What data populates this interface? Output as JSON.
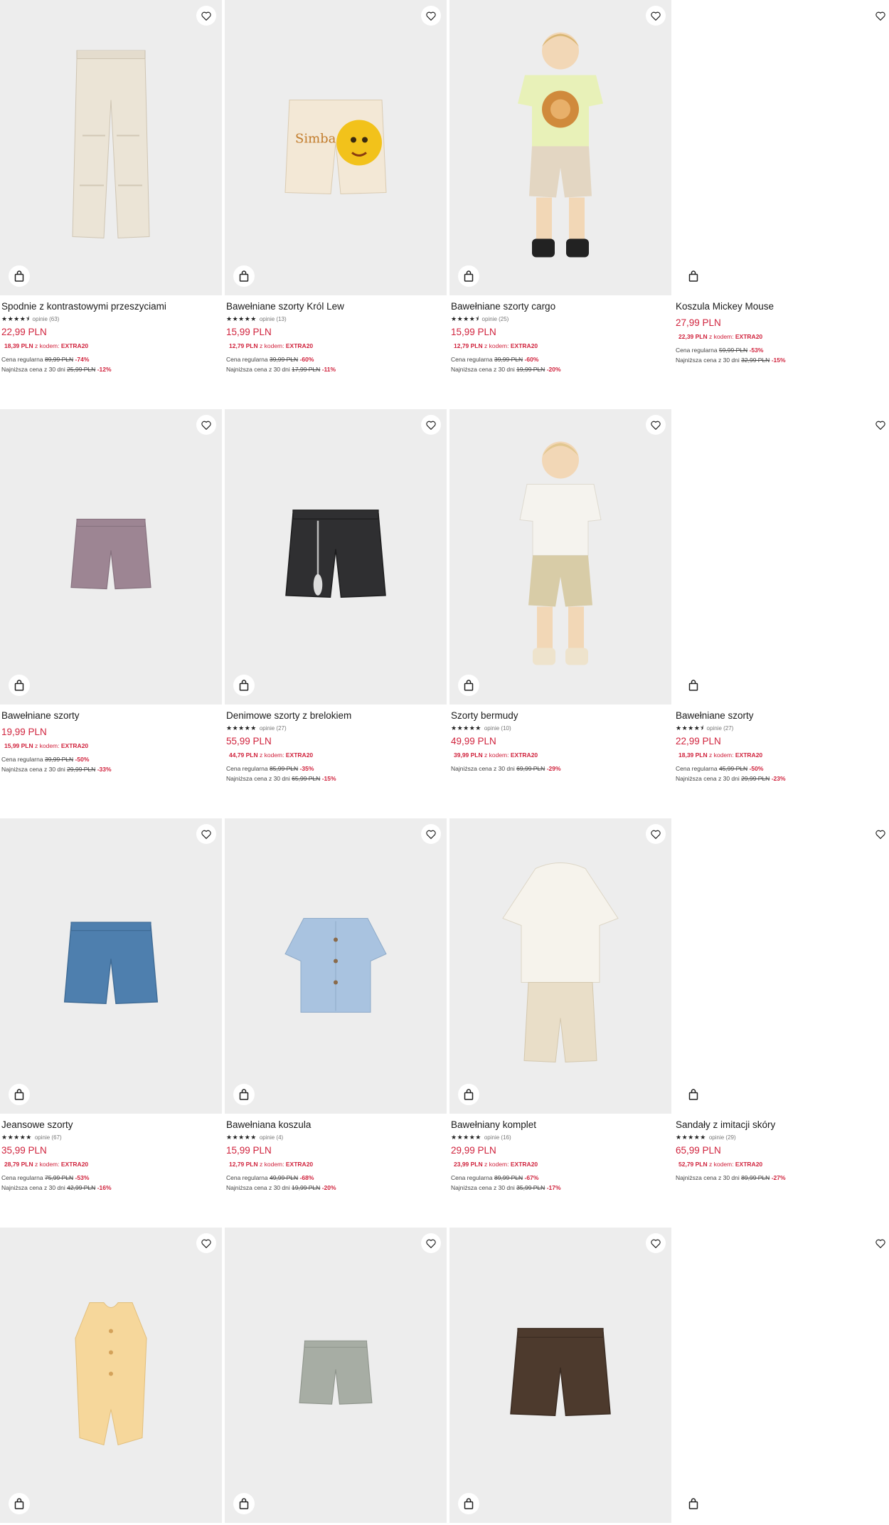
{
  "colors": {
    "price": "#d0223c",
    "image_bg": "#ededed"
  },
  "icons": {
    "wishlist": "heart-outline-icon",
    "cart": "shopping-bag-icon",
    "star": "star-icon"
  },
  "products": [
    {
      "name": "Spodnie z kontrastowymi przeszyciami",
      "rating": 4.5,
      "stars": "★★★★⯨",
      "reviews": "opinie (63)",
      "price": "22,99 PLN",
      "promo_price": "18,39 PLN",
      "promo_text": "z kodem:",
      "promo_code": "EXTRA20",
      "regular_label": "Cena regularna",
      "regular_old": "89,99 PLN",
      "regular_pct": "-74%",
      "lowest_label": "Najniższa cena z 30 dni",
      "lowest_old": "25,99 PLN",
      "lowest_pct": "-12%"
    },
    {
      "name": "Bawełniane szorty Król Lew",
      "rating": 5,
      "stars": "★★★★★",
      "reviews": "opinie (13)",
      "price": "15,99 PLN",
      "promo_price": "12,79 PLN",
      "promo_text": "z kodem:",
      "promo_code": "EXTRA20",
      "regular_label": "Cena regularna",
      "regular_old": "39,99 PLN",
      "regular_pct": "-60%",
      "lowest_label": "Najniższa cena z 30 dni",
      "lowest_old": "17,99 PLN",
      "lowest_pct": "-11%"
    },
    {
      "name": "Bawełniane szorty cargo",
      "rating": 4.5,
      "stars": "★★★★⯨",
      "reviews": "opinie (25)",
      "price": "15,99 PLN",
      "promo_price": "12,79 PLN",
      "promo_text": "z kodem:",
      "promo_code": "EXTRA20",
      "regular_label": "Cena regularna",
      "regular_old": "39,99 PLN",
      "regular_pct": "-60%",
      "lowest_label": "Najniższa cena z 30 dni",
      "lowest_old": "19,99 PLN",
      "lowest_pct": "-20%"
    },
    {
      "name": "Koszula Mickey Mouse",
      "price": "27,99 PLN",
      "promo_price": "22,39 PLN",
      "promo_text": "z kodem:",
      "promo_code": "EXTRA20",
      "regular_label": "Cena regularna",
      "regular_old": "59,99 PLN",
      "regular_pct": "-53%",
      "lowest_label": "Najniższa cena z 30 dni",
      "lowest_old": "32,99 PLN",
      "lowest_pct": "-15%"
    },
    {
      "name": "Bawełniane szorty",
      "price": "19,99 PLN",
      "promo_price": "15,99 PLN",
      "promo_text": "z kodem:",
      "promo_code": "EXTRA20",
      "regular_label": "Cena regularna",
      "regular_old": "39,99 PLN",
      "regular_pct": "-50%",
      "lowest_label": "Najniższa cena z 30 dni",
      "lowest_old": "29,99 PLN",
      "lowest_pct": "-33%"
    },
    {
      "name": "Denimowe szorty z brelokiem",
      "rating": 5,
      "stars": "★★★★★",
      "reviews": "opinie (27)",
      "price": "55,99 PLN",
      "promo_price": "44,79 PLN",
      "promo_text": "z kodem:",
      "promo_code": "EXTRA20",
      "regular_label": "Cena regularna",
      "regular_old": "85,99 PLN",
      "regular_pct": "-35%",
      "lowest_label": "Najniższa cena z 30 dni",
      "lowest_old": "65,99 PLN",
      "lowest_pct": "-15%"
    },
    {
      "name": "Szorty bermudy",
      "rating": 5,
      "stars": "★★★★★",
      "reviews": "opinie (10)",
      "price": "49,99 PLN",
      "promo_price": "39,99 PLN",
      "promo_text": "z kodem:",
      "promo_code": "EXTRA20",
      "lowest_label": "Najniższa cena z 30 dni",
      "lowest_old": "69,99 PLN",
      "lowest_pct": "-29%"
    },
    {
      "name": "Bawełniane szorty",
      "rating": 4.5,
      "stars": "★★★★⯨",
      "reviews": "opinie (27)",
      "price": "22,99 PLN",
      "promo_price": "18,39 PLN",
      "promo_text": "z kodem:",
      "promo_code": "EXTRA20",
      "regular_label": "Cena regularna",
      "regular_old": "45,99 PLN",
      "regular_pct": "-50%",
      "lowest_label": "Najniższa cena z 30 dni",
      "lowest_old": "29,99 PLN",
      "lowest_pct": "-23%"
    },
    {
      "name": "Jeansowe szorty",
      "rating": 5,
      "stars": "★★★★★",
      "reviews": "opinie (67)",
      "price": "35,99 PLN",
      "promo_price": "28,79 PLN",
      "promo_text": "z kodem:",
      "promo_code": "EXTRA20",
      "regular_label": "Cena regularna",
      "regular_old": "75,99 PLN",
      "regular_pct": "-53%",
      "lowest_label": "Najniższa cena z 30 dni",
      "lowest_old": "42,99 PLN",
      "lowest_pct": "-16%"
    },
    {
      "name": "Bawełniana koszula",
      "rating": 5,
      "stars": "★★★★★",
      "reviews": "opinie (4)",
      "price": "15,99 PLN",
      "promo_price": "12,79 PLN",
      "promo_text": "z kodem:",
      "promo_code": "EXTRA20",
      "regular_label": "Cena regularna",
      "regular_old": "49,99 PLN",
      "regular_pct": "-68%",
      "lowest_label": "Najniższa cena z 30 dni",
      "lowest_old": "19,99 PLN",
      "lowest_pct": "-20%"
    },
    {
      "name": "Bawełniany komplet",
      "rating": 5,
      "stars": "★★★★★",
      "reviews": "opinie (16)",
      "price": "29,99 PLN",
      "promo_price": "23,99 PLN",
      "promo_text": "z kodem:",
      "promo_code": "EXTRA20",
      "regular_label": "Cena regularna",
      "regular_old": "89,99 PLN",
      "regular_pct": "-67%",
      "lowest_label": "Najniższa cena z 30 dni",
      "lowest_old": "35,99 PLN",
      "lowest_pct": "-17%"
    },
    {
      "name": "Sandały z imitacji skóry",
      "rating": 5,
      "stars": "★★★★★",
      "reviews": "opinie (29)",
      "price": "65,99 PLN",
      "promo_price": "52,79 PLN",
      "promo_text": "z kodem:",
      "promo_code": "EXTRA20",
      "lowest_label": "Najniższa cena z 30 dni",
      "lowest_old": "89,99 PLN",
      "lowest_pct": "-27%"
    },
    {
      "name": ""
    },
    {
      "name": ""
    },
    {
      "name": ""
    },
    {
      "name": ""
    }
  ]
}
